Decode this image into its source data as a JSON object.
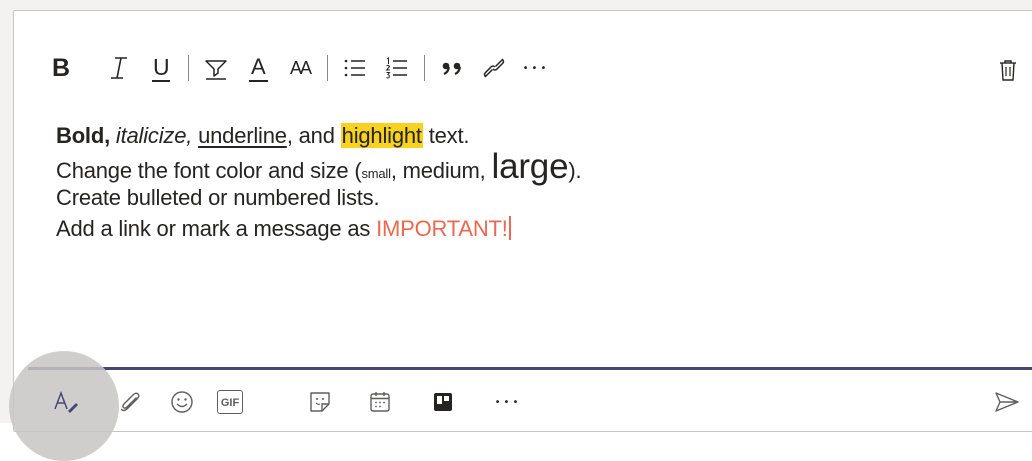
{
  "toolbar": {
    "bold_label": "B",
    "underline_label": "U",
    "font_color_label": "A",
    "font_size_label": "AA",
    "more_label": "•••"
  },
  "editor": {
    "line1": {
      "bold": "Bold,",
      "italic": "italicize,",
      "underline": "underline",
      "and": ", and ",
      "highlight": "highlight",
      "rest": " text."
    },
    "line2": {
      "prefix": "Change the font color and size (",
      "small": "small",
      "comma1": ", medium, ",
      "large": "large",
      "suffix": ")."
    },
    "line3": "Create bulleted or numbered lists.",
    "line4": {
      "prefix": "Add a link or mark a message as ",
      "important": "IMPORTANT!"
    }
  },
  "bottom_toolbar": {
    "gif_label": "GIF",
    "more_label": "•••"
  },
  "colors": {
    "accent": "#464775",
    "highlight": "#f8d21f",
    "important": "#e96a50"
  }
}
